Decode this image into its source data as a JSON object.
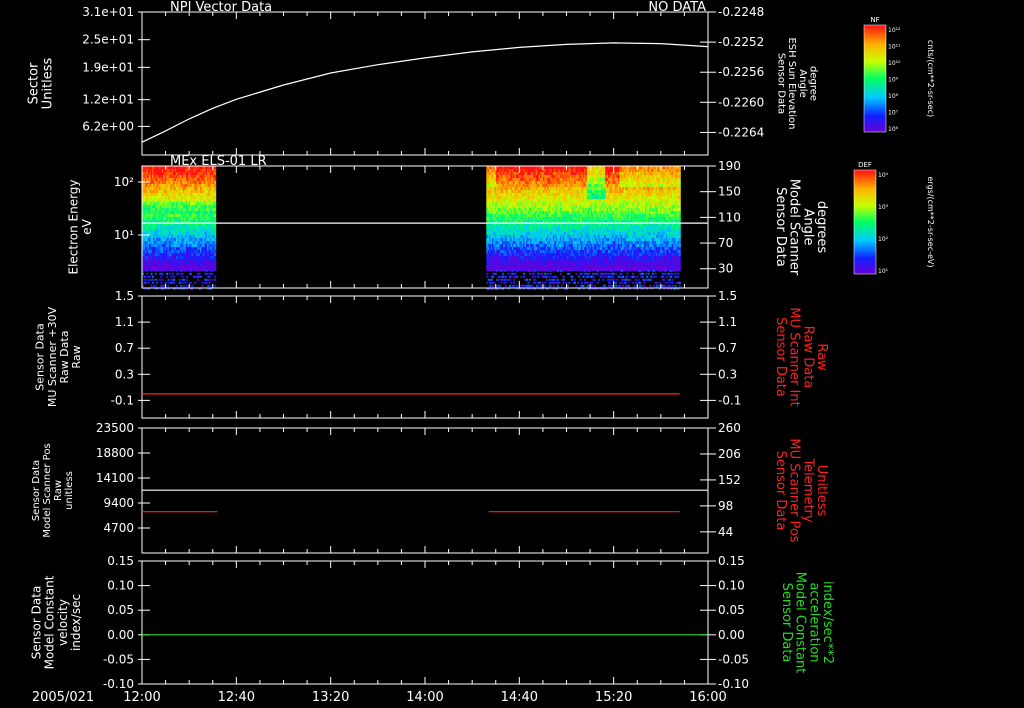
{
  "colors": {
    "white": "#ffffff",
    "red": "#ff2020",
    "green": "#22dd22",
    "black": "#000000"
  },
  "time_axis": {
    "date_label": "2005/021",
    "ticks": [
      "12:00",
      "12:40",
      "13:20",
      "14:00",
      "14:40",
      "15:20",
      "16:00"
    ],
    "range_minutes": [
      0,
      240
    ]
  },
  "chart_data": [
    {
      "type": "line",
      "title": "NPI Vector Data",
      "status_label": "NO DATA",
      "ylabel": [
        "Sector",
        "Unitless"
      ],
      "y_ticks": [
        "3.1e+01",
        "2.5e+01",
        "1.9e+01",
        "1.2e+01",
        "6.2e+00"
      ],
      "y_tick_values": [
        31,
        25,
        19,
        12,
        6.2
      ],
      "ylim": [
        0,
        31
      ],
      "right_ylabel": [
        "Sensor Data",
        "ESH Sun Elevation",
        "Angle",
        "degree"
      ],
      "right_y_ticks": [
        "-0.2248",
        "-0.2252",
        "-0.2256",
        "-0.2260",
        "-0.2264"
      ],
      "right_y_tick_values": [
        -0.2248,
        -0.2252,
        -0.2256,
        -0.226,
        -0.2264
      ],
      "right_ylim": [
        -0.2267,
        -0.2248
      ],
      "series": [
        {
          "axis": "right",
          "color": "white",
          "x": [
            0,
            10,
            20,
            30,
            40,
            60,
            80,
            100,
            120,
            140,
            160,
            180,
            200,
            220,
            240
          ],
          "y": [
            -0.22653,
            -0.22638,
            -0.22622,
            -0.22608,
            -0.22596,
            -0.22577,
            -0.22561,
            -0.2255,
            -0.22541,
            -0.22533,
            -0.22527,
            -0.22523,
            -0.22521,
            -0.22522,
            -0.22526
          ]
        }
      ],
      "colorbar": {
        "label": "NF",
        "units": "cnts/(cm**2-sr-sec)",
        "ticks": [
          "10¹²",
          "10¹¹",
          "10¹⁰",
          "10⁹",
          "10⁸",
          "10⁷",
          "10⁶"
        ]
      }
    },
    {
      "type": "heatmap",
      "title": "MEx ELS-01 LR",
      "ylabel": [
        "Electron Energy",
        "eV"
      ],
      "y_ticks": [
        "10²",
        "10¹"
      ],
      "y_tick_values": [
        100,
        10
      ],
      "y_scale": "log",
      "ylim": [
        1,
        200
      ],
      "right_ylabel": [
        "Sensor Data",
        "Model Scanner",
        "Angle",
        "degrees"
      ],
      "right_y_ticks": [
        "190",
        "150",
        "110",
        "70",
        "30"
      ],
      "right_y_tick_values": [
        190,
        150,
        110,
        70,
        30
      ],
      "right_ylim": [
        0,
        190
      ],
      "data_intervals": [
        [
          0,
          31
        ],
        [
          146,
          228
        ]
      ],
      "series": [
        {
          "axis": "right",
          "color": "white",
          "x": [
            0,
            240
          ],
          "y": [
            101,
            101
          ]
        }
      ],
      "colorbar": {
        "label": "DEF",
        "units": "ergs/(cm**2-sr-sec-eV)",
        "ticks": [
          "10⁴",
          "10³",
          "10²",
          "10¹"
        ]
      }
    },
    {
      "type": "line",
      "ylabel": [
        "Sensor Data",
        "MU Scanner +30V",
        "Raw Data",
        "Raw"
      ],
      "y_ticks": [
        "1.5",
        "1.1",
        "0.7",
        "0.3",
        "-0.1"
      ],
      "y_tick_values": [
        1.5,
        1.1,
        0.7,
        0.3,
        -0.1
      ],
      "ylim": [
        -0.37,
        1.5
      ],
      "right_ylabel": [
        "Sensor Data",
        "MU Scanner Int",
        "Raw Data",
        "Raw"
      ],
      "right_ylabel_color": "red",
      "right_y_ticks": [
        "1.5",
        "1.1",
        "0.7",
        "0.3",
        "-0.1"
      ],
      "right_y_tick_values": [
        1.5,
        1.1,
        0.7,
        0.3,
        -0.1
      ],
      "right_ylim": [
        -0.37,
        1.5
      ],
      "series": [
        {
          "axis": "right",
          "color": "red",
          "x": [
            0,
            228
          ],
          "y": [
            0,
            0
          ]
        }
      ]
    },
    {
      "type": "line",
      "ylabel": [
        "Sensor Data",
        "Model Scanner Pos",
        "Raw",
        "unitless"
      ],
      "y_ticks": [
        "23500",
        "18800",
        "14100",
        "9400",
        "4700"
      ],
      "y_tick_values": [
        23500,
        18800,
        14100,
        9400,
        4700
      ],
      "ylim": [
        0,
        23500
      ],
      "right_ylabel": [
        "Sensor Data",
        "MU Scanner Pos",
        "Telemetry",
        "Unitless"
      ],
      "right_ylabel_color": "red",
      "right_y_ticks": [
        "260",
        "206",
        "152",
        "98",
        "44"
      ],
      "right_y_tick_values": [
        260,
        206,
        152,
        98,
        44
      ],
      "right_ylim": [
        0,
        260
      ],
      "series": [
        {
          "axis": "left",
          "color": "white",
          "x": [
            0,
            240
          ],
          "y": [
            11800,
            11800
          ]
        },
        {
          "axis": "right",
          "color": "red",
          "x": [
            0,
            32
          ],
          "y": [
            86,
            86
          ]
        },
        {
          "axis": "right",
          "color": "red",
          "x": [
            147,
            228
          ],
          "y": [
            86,
            86
          ]
        }
      ]
    },
    {
      "type": "line",
      "ylabel": [
        "Sensor Data",
        "Model Constant",
        "velocity",
        "index/sec"
      ],
      "y_ticks": [
        "0.15",
        "0.10",
        "0.05",
        "0.00",
        "-0.05",
        "-0.10"
      ],
      "y_tick_values": [
        0.15,
        0.1,
        0.05,
        0,
        -0.05,
        -0.1
      ],
      "ylim": [
        -0.1,
        0.15
      ],
      "right_ylabel": [
        "Sensor Data",
        "Model Constant",
        "acceleration",
        "index/sec**2"
      ],
      "right_ylabel_color": "green",
      "right_y_ticks": [
        "0.15",
        "0.10",
        "0.05",
        "0.00",
        "-0.05",
        "-0.10"
      ],
      "right_y_tick_values": [
        0.15,
        0.1,
        0.05,
        0,
        -0.05,
        -0.1
      ],
      "right_ylim": [
        -0.1,
        0.15
      ],
      "series": [
        {
          "axis": "right",
          "color": "green",
          "x": [
            0,
            240
          ],
          "y": [
            0,
            0
          ]
        }
      ]
    }
  ]
}
